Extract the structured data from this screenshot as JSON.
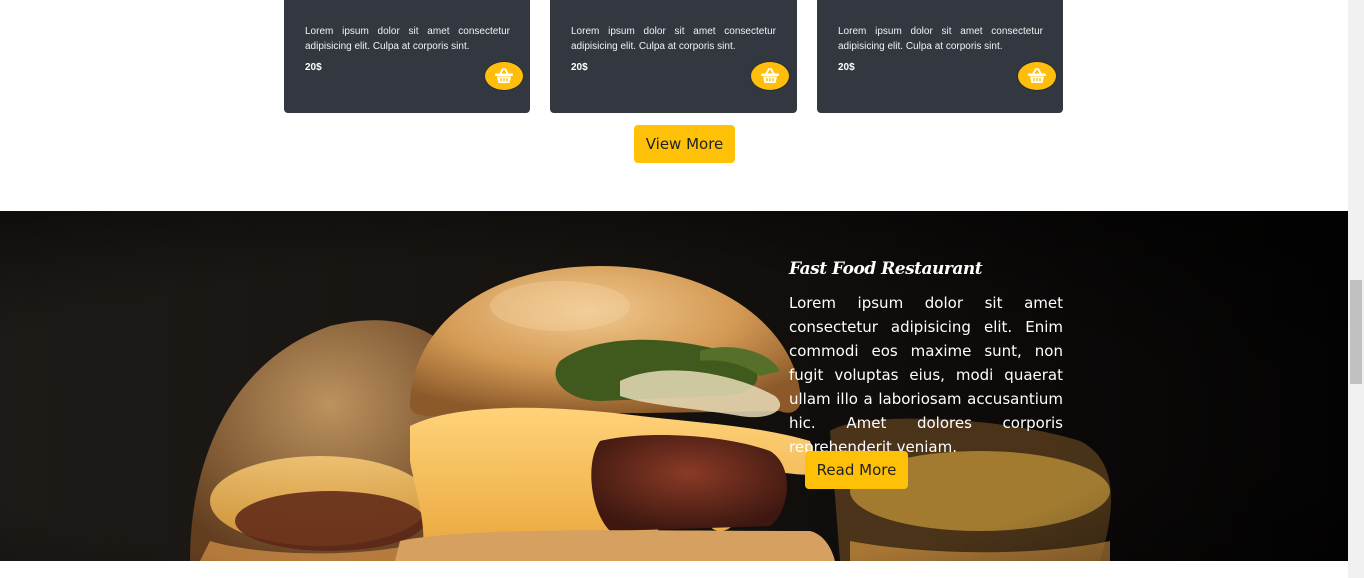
{
  "products": [
    {
      "description": "Lorem ipsum dolor sit amet consectetur adipisicing elit. Culpa at corporis sint.",
      "price": "20$",
      "cart_icon": "basket-icon"
    },
    {
      "description": "Lorem ipsum dolor sit amet consectetur adipisicing elit. Culpa at corporis sint.",
      "price": "20$",
      "cart_icon": "basket-icon"
    },
    {
      "description": "Lorem ipsum dolor sit amet consectetur adipisicing elit. Culpa at corporis sint.",
      "price": "20$",
      "cart_icon": "basket-icon"
    }
  ],
  "view_more_label": "View More",
  "hero": {
    "title": "Fast Food Restaurant",
    "text": "Lorem ipsum dolor sit amet consectetur adipisicing elit. Enim commodi eos maxime sunt, non fugit voluptas eius, modi quaerat ullam illo a laboriosam accusantium hic. Amet dolores corporis reprehenderit veniam.",
    "read_more_label": "Read More"
  },
  "colors": {
    "accent": "#ffc107",
    "card_bg": "#33373f",
    "hero_bg": "#15120f"
  }
}
